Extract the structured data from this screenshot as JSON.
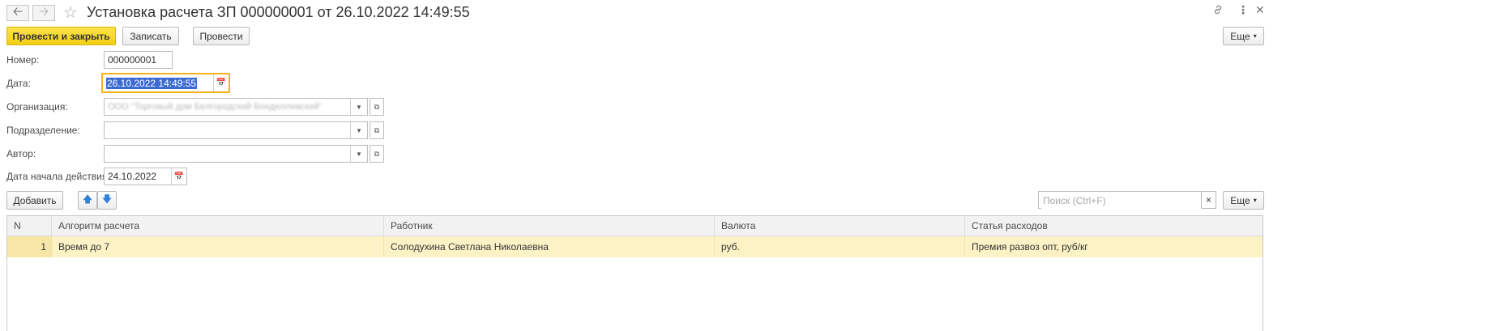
{
  "titlebar": {
    "title": "Установка расчета ЗП 000000001 от 26.10.2022 14:49:55",
    "back_icon": "arrow-left-icon",
    "forward_icon": "arrow-right-icon",
    "favorite_icon": "star-icon",
    "link_icon": "link-icon",
    "more_icon": "more-icon",
    "close_icon": "close-icon"
  },
  "toolbar": {
    "post_and_close": "Провести и закрыть",
    "save": "Записать",
    "post": "Провести",
    "more": "Еще"
  },
  "form": {
    "number_label": "Номер:",
    "number_value": "000000001",
    "date_label": "Дата:",
    "date_value": "26.10.2022 14:49:55",
    "org_label": "Организация:",
    "org_value": "ООО \"Торговый дом Белгородский Бондюэлевский\"",
    "dept_label": "Подразделение:",
    "dept_value": "",
    "author_label": "Автор:",
    "author_value": "",
    "start_date_label": "Дата начала действия:",
    "start_date_value": "24.10.2022"
  },
  "table_toolbar": {
    "add": "Добавить",
    "search_placeholder": "Поиск (Ctrl+F)",
    "more": "Еще",
    "clear": "×"
  },
  "table": {
    "columns": [
      "N",
      "Алгоритм расчета",
      "Работник",
      "Валюта",
      "Статья расходов"
    ],
    "rows": [
      {
        "n": "1",
        "algorithm": "Время до 7",
        "employee": "Солодухина Светлана Николаевна",
        "currency": "руб.",
        "expense": "Премия развоз опт, руб/кг"
      }
    ]
  },
  "colors": {
    "primary_button": "#f3cf14",
    "focus_border": "#f5b31a",
    "selection": "#3b6bd1",
    "selected_row": "#fdf2c6"
  }
}
